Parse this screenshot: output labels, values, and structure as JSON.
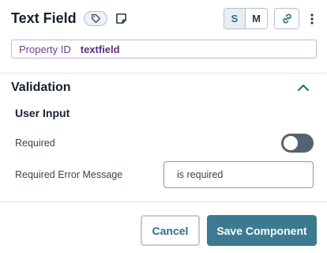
{
  "header": {
    "title": "Text Field",
    "size_options": [
      "S",
      "M"
    ],
    "selected_size": "S",
    "icons": [
      "tag-icon",
      "note-icon",
      "link-icon",
      "more-vertical-icon"
    ]
  },
  "property": {
    "label": "Property ID",
    "value": "textfield"
  },
  "validation": {
    "title": "Validation",
    "expanded": true,
    "subsection": "User Input",
    "required_label": "Required",
    "required_on": false,
    "error_message_label": "Required Error Message",
    "error_message_value": "is required"
  },
  "footer": {
    "cancel_label": "Cancel",
    "save_label": "Save Component"
  },
  "colors": {
    "accent": "#3b7a91",
    "property_border": "#c9b4dd",
    "property_text": "#5a2d85",
    "toggle_off": "#55626e"
  }
}
